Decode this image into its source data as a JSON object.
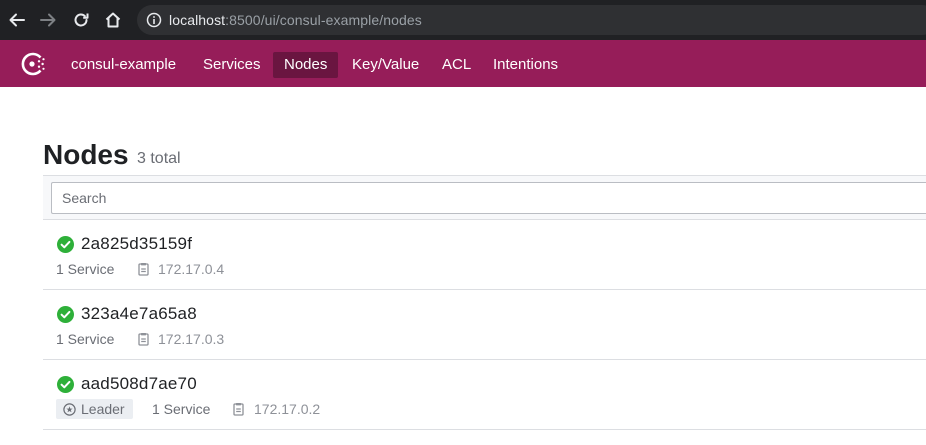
{
  "browser": {
    "url_host": "localhost",
    "url_rest": ":8500/ui/consul-example/nodes"
  },
  "header": {
    "datacenter": "consul-example",
    "nav": [
      {
        "label": "Services",
        "active": false
      },
      {
        "label": "Nodes",
        "active": true
      },
      {
        "label": "Key/Value",
        "active": false
      },
      {
        "label": "ACL",
        "active": false
      },
      {
        "label": "Intentions",
        "active": false
      }
    ]
  },
  "page": {
    "title": "Nodes",
    "count": "3 total"
  },
  "search": {
    "placeholder": "Search",
    "value": ""
  },
  "nodes": [
    {
      "name": "2a825d35159f",
      "services": "1 Service",
      "address": "172.17.0.4",
      "status": "passing",
      "leader": false
    },
    {
      "name": "323a4e7a65a8",
      "services": "1 Service",
      "address": "172.17.0.3",
      "status": "passing",
      "leader": false
    },
    {
      "name": "aad508d7ae70",
      "services": "1 Service",
      "address": "172.17.0.2",
      "status": "passing",
      "leader": true,
      "leader_label": "Leader"
    }
  ],
  "colors": {
    "header_bg": "#961d59",
    "active_nav_bg": "#6a1540",
    "passing": "#2eb039",
    "browser_bg": "#202124"
  },
  "icons": {
    "back": "arrow-left-icon",
    "forward": "arrow-right-icon",
    "reload": "reload-icon",
    "home": "home-icon",
    "site_info": "info-icon",
    "logo": "consul-logo-icon",
    "status": "check-circle-icon",
    "address": "clipboard-icon",
    "leader": "star-circle-icon"
  }
}
